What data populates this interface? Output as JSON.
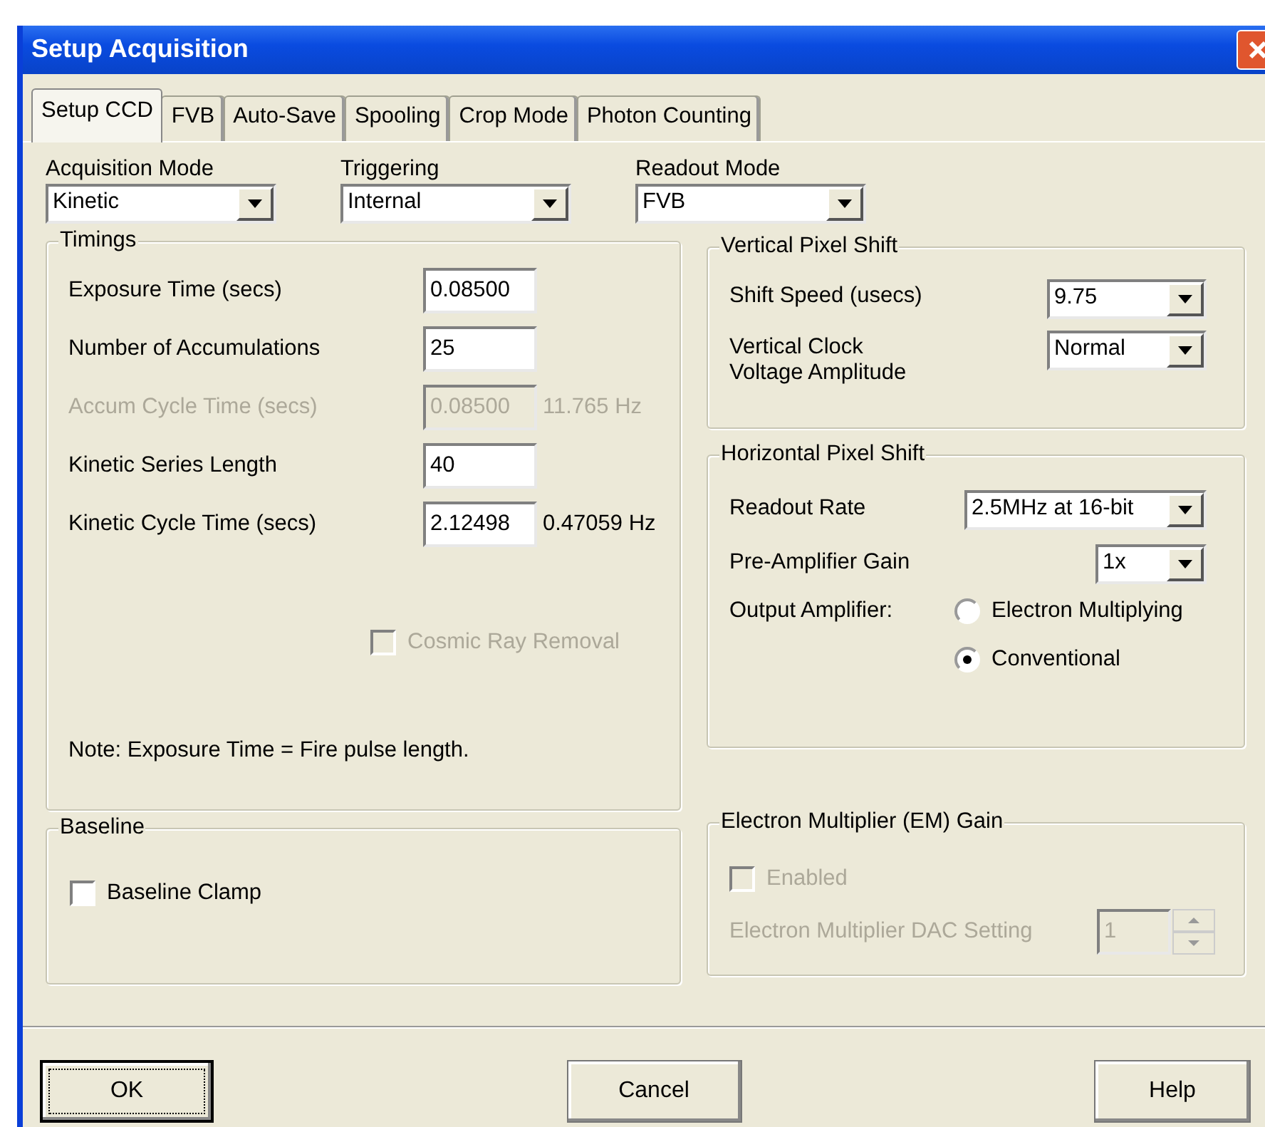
{
  "window": {
    "title": "Setup Acquisition"
  },
  "tabs": [
    {
      "label": "Setup CCD",
      "selected": true
    },
    {
      "label": "FVB",
      "selected": false
    },
    {
      "label": "Auto-Save",
      "selected": false
    },
    {
      "label": "Spooling",
      "selected": false
    },
    {
      "label": "Crop Mode",
      "selected": false
    },
    {
      "label": "Photon Counting",
      "selected": false
    }
  ],
  "top_selects": [
    {
      "label": "Acquisition Mode",
      "value": "Kinetic"
    },
    {
      "label": "Triggering",
      "value": "Internal"
    },
    {
      "label": "Readout Mode",
      "value": "FVB"
    }
  ],
  "timings": {
    "title": "Timings",
    "rows": [
      {
        "label": "Exposure Time (secs)",
        "value": "0.08500",
        "disabled": false
      },
      {
        "label": "Number of Accumulations",
        "value": "25",
        "disabled": false
      },
      {
        "label": "Accum Cycle Time (secs)",
        "value": "0.08500",
        "disabled": true,
        "reading": "11.765 Hz"
      },
      {
        "label": "Kinetic Series Length",
        "value": "40",
        "disabled": false
      },
      {
        "label": "Kinetic Cycle Time (secs)",
        "value": "2.12498",
        "disabled": false,
        "reading": "0.47059 Hz"
      }
    ],
    "cosmic_ray": {
      "label": "Cosmic Ray Removal",
      "checked": false,
      "disabled": true
    },
    "note": "Note: Exposure Time = Fire pulse length."
  },
  "baseline": {
    "title": "Baseline",
    "checkbox": {
      "label": "Baseline Clamp",
      "checked": false
    }
  },
  "vertical_pixel_shift": {
    "title": "Vertical Pixel Shift",
    "rows": [
      {
        "label": "Shift Speed (usecs)",
        "value": "9.75"
      },
      {
        "label": "Vertical Clock\nVoltage Amplitude",
        "value": "Normal"
      }
    ]
  },
  "horizontal_pixel_shift": {
    "title": "Horizontal Pixel Shift",
    "rows": [
      {
        "label": "Readout Rate",
        "value": "2.5MHz at 16-bit",
        "kind": "wide"
      },
      {
        "label": "Pre-Amplifier Gain",
        "value": "1x",
        "kind": "narrow"
      }
    ],
    "output_amplifier": {
      "label": "Output Amplifier:",
      "options": [
        {
          "label": "Electron Multiplying",
          "selected": false
        },
        {
          "label": "Conventional",
          "selected": true
        }
      ]
    }
  },
  "em_gain": {
    "title": "Electron Multiplier (EM) Gain",
    "enabled": {
      "label": "Enabled",
      "checked": false,
      "disabled": true
    },
    "dac": {
      "label": "Electron Multiplier DAC Setting",
      "value": "1",
      "disabled": true
    }
  },
  "buttons": [
    {
      "label": "OK",
      "default": true
    },
    {
      "label": "Cancel",
      "default": false
    },
    {
      "label": "Help",
      "default": false
    }
  ]
}
